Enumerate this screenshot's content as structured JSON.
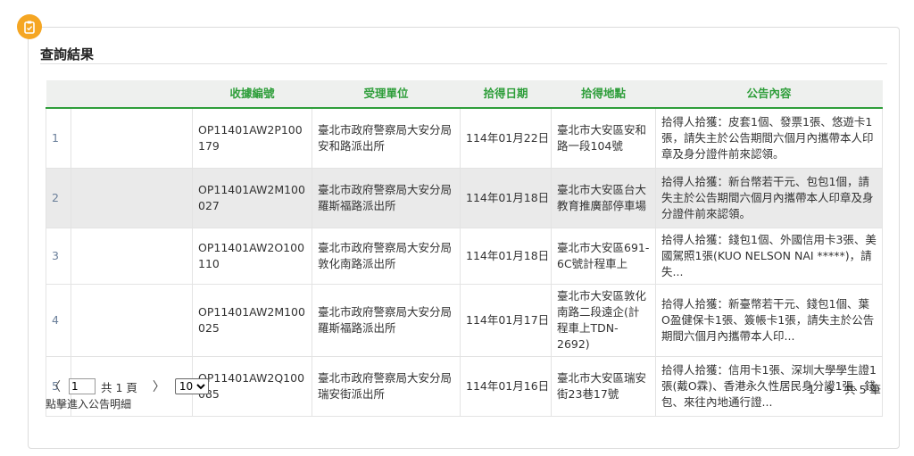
{
  "section_title": "查詢結果",
  "table": {
    "headers": [
      "",
      "",
      "收據編號",
      "受理單位",
      "拾得日期",
      "拾得地點",
      "公告內容"
    ],
    "rows": [
      {
        "index": "1",
        "receipt_no": "OP11401AW2P100179",
        "unit": "臺北市政府警察局大安分局安和路派出所",
        "date": "114年01月22日",
        "location": "臺北市大安區安和路一段104號",
        "content": "拾得人拾獲：皮套1個、發票1張、悠遊卡1張，請失主於公告期間六個月內攜帶本人印章及身分證件前來認領。"
      },
      {
        "index": "2",
        "receipt_no": "OP11401AW2M100027",
        "unit": "臺北市政府警察局大安分局羅斯福路派出所",
        "date": "114年01月18日",
        "location": "臺北市大安區台大教育推廣部停車場",
        "content": "拾得人拾獲：新台幣若干元、包包1個，請失主於公告期間六個月內攜帶本人印章及身分證件前來認領。"
      },
      {
        "index": "3",
        "receipt_no": "OP11401AW2O100110",
        "unit": "臺北市政府警察局大安分局敦化南路派出所",
        "date": "114年01月18日",
        "location": "臺北市大安區691-6C號計程車上",
        "content": "拾得人拾獲：錢包1個、外國信用卡3張、美國駕照1張(KUO NELSON NAI *****)，請失..."
      },
      {
        "index": "4",
        "receipt_no": "OP11401AW2M100025",
        "unit": "臺北市政府警察局大安分局羅斯福路派出所",
        "date": "114年01月17日",
        "location": "臺北市大安區敦化南路二段遠企(計程車上TDN-2692)",
        "content": "拾得人拾獲：新臺幣若干元、錢包1個、葉O盈健保卡1張、簽帳卡1張，請失主於公告期間六個月內攜帶本人印..."
      },
      {
        "index": "5",
        "receipt_no": "OP11401AW2Q100085",
        "unit": "臺北市政府警察局大安分局瑞安街派出所",
        "date": "114年01月16日",
        "location": "臺北市大安區瑞安街23巷17號",
        "content": "拾得人拾獲：信用卡1張、深圳大學學生證1張(戴O霖)、香港永久性居民身分證1張、錢包、來往內地通行證..."
      }
    ]
  },
  "pager": {
    "prev": "〈",
    "next": "〉",
    "page_value": "1",
    "total_pages": "共 1 頁",
    "page_size": "10",
    "range_text": "1 - 5　共 5 筆"
  },
  "hint": "點擊進入公告明細",
  "colors": {
    "accent_green": "#2e9e3a",
    "badge_orange": "#f5a623",
    "row_alt": "#eaeaea"
  },
  "icons": {
    "badge": "clipboard-icon"
  }
}
